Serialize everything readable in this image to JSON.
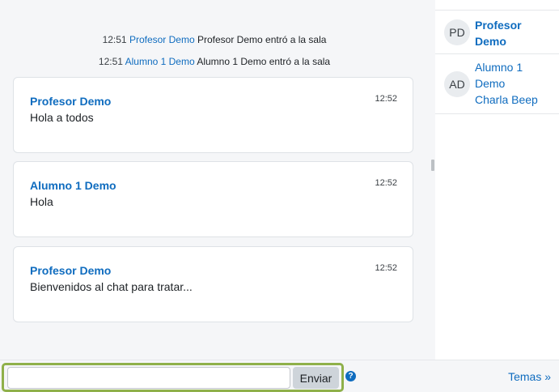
{
  "system_messages": [
    {
      "time": "12:51",
      "user": "Profesor Demo",
      "text": "Profesor Demo entró a la sala"
    },
    {
      "time": "12:51",
      "user": "Alumno 1 Demo",
      "text": "Alumno 1 Demo entró a la sala"
    }
  ],
  "messages": [
    {
      "author": "Profesor Demo",
      "time": "12:52",
      "text": "Hola a todos"
    },
    {
      "author": "Alumno 1 Demo",
      "time": "12:52",
      "text": "Hola"
    },
    {
      "author": "Profesor Demo",
      "time": "12:52",
      "text": "Bienvenidos al chat para tratar..."
    }
  ],
  "users": [
    {
      "initials": "PD",
      "name_line1": "Profesor",
      "name_line2": "Demo",
      "beep": ""
    },
    {
      "initials": "AD",
      "name_line1": "Alumno 1",
      "name_line2": "Demo",
      "beep": "Charla Beep"
    }
  ],
  "composer": {
    "input_value": "",
    "send_label": "Enviar",
    "help_glyph": "?"
  },
  "themes_link": "Temas »",
  "colors": {
    "accent": "#0f6cbf",
    "highlight": "#8fb04a"
  }
}
